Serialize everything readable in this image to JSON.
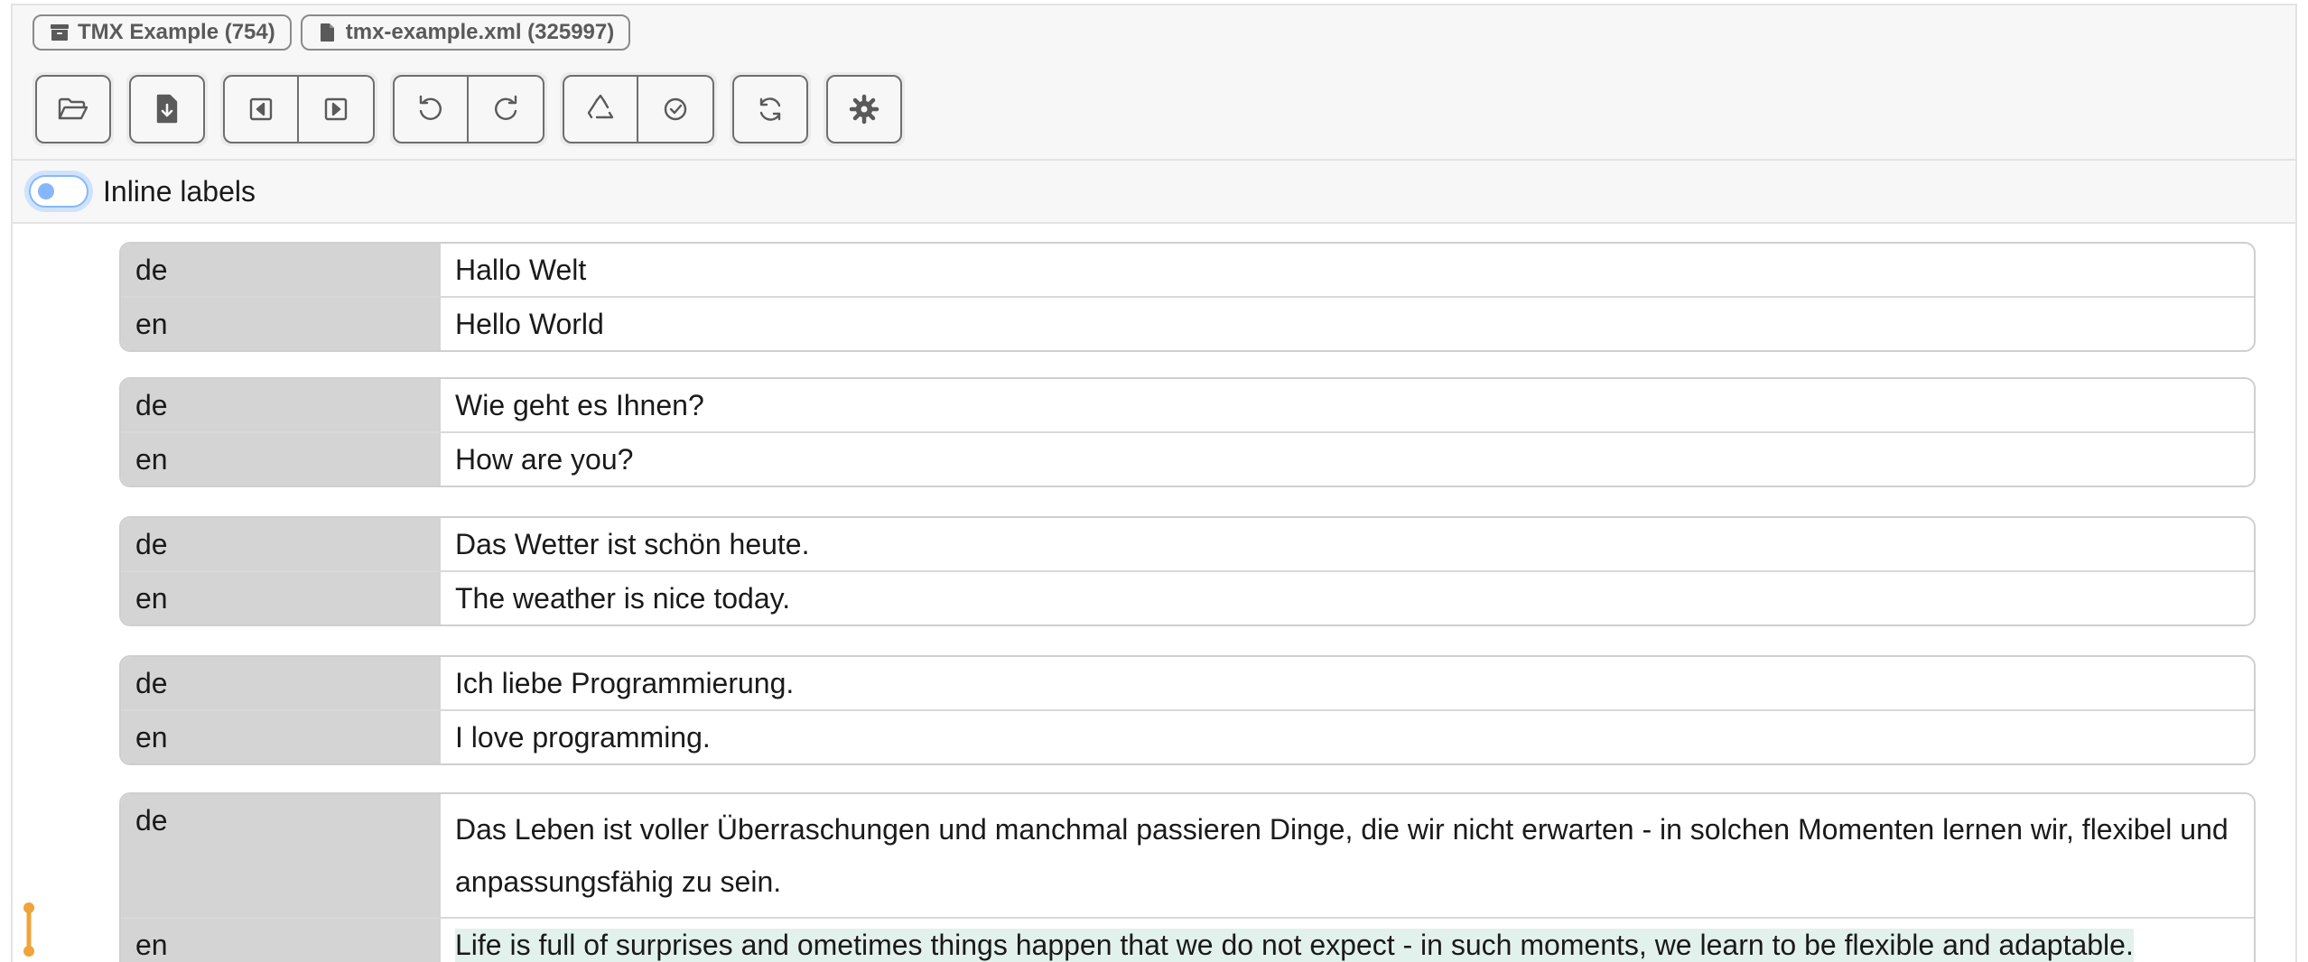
{
  "header": {
    "project_chip": "TMX Example (754)",
    "file_chip": "tmx-example.xml (325997)"
  },
  "toolbar": {
    "icons": [
      "folder-open-icon",
      "file-download-icon",
      "prev-icon",
      "next-icon",
      "undo-icon",
      "redo-icon",
      "recycle-icon",
      "check-circle-icon",
      "sync-icon",
      "gear-icon"
    ]
  },
  "labels_toggle": {
    "label": "Inline labels",
    "checked": false
  },
  "units": [
    {
      "rows": [
        {
          "lang": "de",
          "text": "Hallo Welt"
        },
        {
          "lang": "en",
          "text": "Hello World"
        }
      ]
    },
    {
      "rows": [
        {
          "lang": "de",
          "text": "Wie geht es Ihnen?"
        },
        {
          "lang": "en",
          "text": "How are you?"
        }
      ]
    },
    {
      "rows": [
        {
          "lang": "de",
          "text": "Das Wetter ist schön heute."
        },
        {
          "lang": "en",
          "text": "The weather is nice today."
        }
      ]
    },
    {
      "rows": [
        {
          "lang": "de",
          "text": "Ich liebe Programmierung."
        },
        {
          "lang": "en",
          "text": "I love programming."
        }
      ]
    },
    {
      "rows": [
        {
          "lang": "de",
          "text": "Das Leben ist voller Überraschungen und manchmal passieren Dinge, die wir nicht erwarten - in solchen Momenten lernen wir, flexibel und anpassungsfähig zu sein."
        },
        {
          "lang": "en",
          "text": "Life is full of surprises and ometimes things happen that we do not expect - in such moments, we learn to be flexible and adaptable."
        }
      ]
    }
  ],
  "colors": {
    "highlight_bg": "#e3f1ec",
    "highlight_underline": "#f0a33a",
    "lang_cell_bg": "#d4d4d4"
  }
}
